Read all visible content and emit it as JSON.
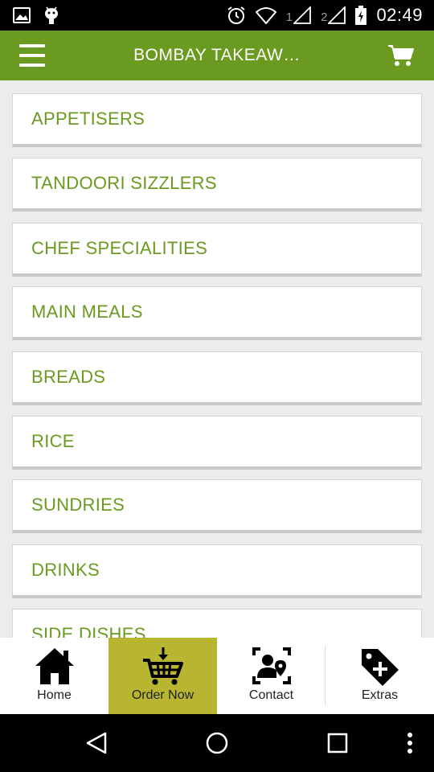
{
  "status_bar": {
    "time": "02:49",
    "sim1": "1",
    "sim2": "2",
    "icons": [
      "image-icon",
      "android-icon",
      "alarm-icon",
      "wifi-icon",
      "signal-icon",
      "battery-icon"
    ]
  },
  "app_bar": {
    "title": "BOMBAY TAKEAW…",
    "menu_icon": "hamburger-icon",
    "cart_icon": "cart-icon"
  },
  "menu": {
    "categories": [
      "APPETISERS",
      "TANDOORI SIZZLERS",
      "CHEF SPECIALITIES",
      "MAIN MEALS",
      "BREADS",
      "RICE",
      "SUNDRIES",
      "DRINKS",
      "SIDE DISHES"
    ]
  },
  "bottom_nav": {
    "tabs": [
      {
        "label": "Home",
        "icon": "home-icon"
      },
      {
        "label": "Order Now",
        "icon": "order-basket-icon"
      },
      {
        "label": "Contact",
        "icon": "contact-icon"
      },
      {
        "label": "Extras",
        "icon": "tag-plus-icon"
      }
    ],
    "active_index": 1
  },
  "colors": {
    "brand_green": "#6a9a1f",
    "active_tab": "#b8b631"
  }
}
